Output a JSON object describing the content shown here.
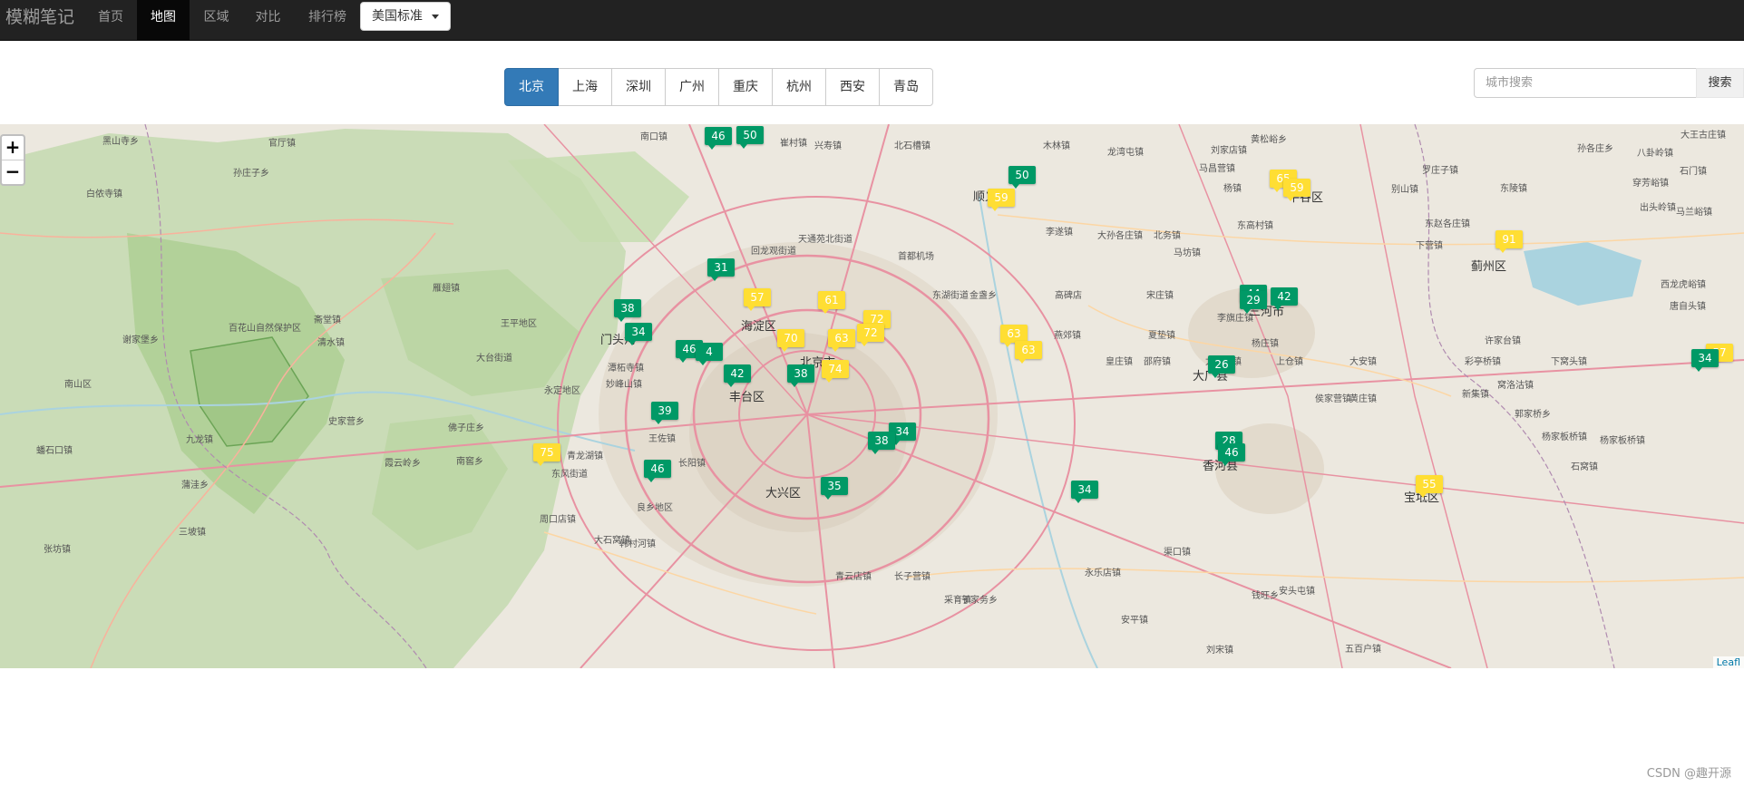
{
  "navbar": {
    "brand": "模糊笔记",
    "items": [
      {
        "label": "首页",
        "active": false
      },
      {
        "label": "地图",
        "active": true
      },
      {
        "label": "区域",
        "active": false
      },
      {
        "label": "对比",
        "active": false
      },
      {
        "label": "排行榜",
        "active": false
      }
    ],
    "dropdown_label": "美国标准"
  },
  "city_tabs": [
    {
      "label": "北京",
      "active": true
    },
    {
      "label": "上海",
      "active": false
    },
    {
      "label": "深圳",
      "active": false
    },
    {
      "label": "广州",
      "active": false
    },
    {
      "label": "重庆",
      "active": false
    },
    {
      "label": "杭州",
      "active": false
    },
    {
      "label": "西安",
      "active": false
    },
    {
      "label": "青岛",
      "active": false
    }
  ],
  "search": {
    "placeholder": "城市搜索",
    "button_label": "搜索"
  },
  "map": {
    "zoom_in": "+",
    "zoom_out": "−",
    "attribution": "Leafl",
    "colors": {
      "good": "#009966",
      "moderate": "#ffde33"
    },
    "labels": [
      {
        "text": "北京市",
        "major": true
      },
      {
        "text": "海淀区",
        "major": true
      },
      {
        "text": "丰台区",
        "major": true
      },
      {
        "text": "大兴区",
        "major": true
      },
      {
        "text": "顺义区",
        "major": true
      },
      {
        "text": "门头沟",
        "major": true
      },
      {
        "text": "大厂县",
        "major": true
      },
      {
        "text": "香河县",
        "major": true
      },
      {
        "text": "三河市",
        "major": true
      },
      {
        "text": "平谷区",
        "major": true
      },
      {
        "text": "蓟州区",
        "major": true
      },
      {
        "text": "宝坻区",
        "major": true
      },
      {
        "text": "百花山自然保护区",
        "major": false
      },
      {
        "text": "官厅镇",
        "major": false
      },
      {
        "text": "南口镇",
        "major": false
      },
      {
        "text": "崔村镇",
        "major": false
      },
      {
        "text": "兴寿镇",
        "major": false
      },
      {
        "text": "北石槽镇",
        "major": false
      },
      {
        "text": "木林镇",
        "major": false
      },
      {
        "text": "龙湾屯镇",
        "major": false
      },
      {
        "text": "刘家店镇",
        "major": false
      },
      {
        "text": "黄松峪乡",
        "major": false
      },
      {
        "text": "马昌营镇",
        "major": false
      },
      {
        "text": "杨镇",
        "major": false
      },
      {
        "text": "李遂镇",
        "major": false
      },
      {
        "text": "北务镇",
        "major": false
      },
      {
        "text": "大孙各庄镇",
        "major": false
      },
      {
        "text": "马坊镇",
        "major": false
      },
      {
        "text": "东高村镇",
        "major": false
      },
      {
        "text": "天通苑北街道",
        "major": false
      },
      {
        "text": "回龙观街道",
        "major": false
      },
      {
        "text": "首都机场",
        "major": false
      },
      {
        "text": "东湖街道",
        "major": false
      },
      {
        "text": "金盏乡",
        "major": false
      },
      {
        "text": "高碑店",
        "major": false
      },
      {
        "text": "宋庄镇",
        "major": false
      },
      {
        "text": "燕郊镇",
        "major": false
      },
      {
        "text": "夏垫镇",
        "major": false
      },
      {
        "text": "李旗庄镇",
        "major": false
      },
      {
        "text": "杨庄镇",
        "major": false
      },
      {
        "text": "邵府镇",
        "major": false
      },
      {
        "text": "皇庄镇",
        "major": false
      },
      {
        "text": "尤古庄镇",
        "major": false
      },
      {
        "text": "上仓镇",
        "major": false
      },
      {
        "text": "大安镇",
        "major": false
      },
      {
        "text": "彩亭桥镇",
        "major": false
      },
      {
        "text": "下窝头镇",
        "major": false
      },
      {
        "text": "新集镇",
        "major": false
      },
      {
        "text": "侯家营镇",
        "major": false
      },
      {
        "text": "黄庄镇",
        "major": false
      },
      {
        "text": "郭家桥乡",
        "major": false
      },
      {
        "text": "杨家板桥镇",
        "major": false
      },
      {
        "text": "石窝镇",
        "major": false
      },
      {
        "text": "良乡地区",
        "major": false
      },
      {
        "text": "长阳镇",
        "major": false
      },
      {
        "text": "王佐镇",
        "major": false
      },
      {
        "text": "青龙湖镇",
        "major": false
      },
      {
        "text": "东风街道",
        "major": false
      },
      {
        "text": "周口店镇",
        "major": false
      },
      {
        "text": "韩村河镇",
        "major": false
      },
      {
        "text": "大石窝镇",
        "major": false
      },
      {
        "text": "佛子庄乡",
        "major": false
      },
      {
        "text": "史家营乡",
        "major": false
      },
      {
        "text": "霞云岭乡",
        "major": false
      },
      {
        "text": "蒲洼乡",
        "major": false
      },
      {
        "text": "南窖乡",
        "major": false
      },
      {
        "text": "九龙镇",
        "major": false
      },
      {
        "text": "三坡镇",
        "major": false
      },
      {
        "text": "清水镇",
        "major": false
      },
      {
        "text": "斋堂镇",
        "major": false
      },
      {
        "text": "雁翅镇",
        "major": false
      },
      {
        "text": "王平地区",
        "major": false
      },
      {
        "text": "大台街道",
        "major": false
      },
      {
        "text": "妙峰山镇",
        "major": false
      },
      {
        "text": "潭柘寺镇",
        "major": false
      },
      {
        "text": "永定地区",
        "major": false
      },
      {
        "text": "黑山寺乡",
        "major": false
      },
      {
        "text": "孙庄子乡",
        "major": false
      },
      {
        "text": "白侬寺镇",
        "major": false
      },
      {
        "text": "谢家堡乡",
        "major": false
      },
      {
        "text": "南山区",
        "major": false
      },
      {
        "text": "蟠石口镇",
        "major": false
      },
      {
        "text": "张坊镇",
        "major": false
      },
      {
        "text": "青云店镇",
        "major": false
      },
      {
        "text": "长子营镇",
        "major": false
      },
      {
        "text": "采育镇",
        "major": false
      },
      {
        "text": "于家务乡",
        "major": false
      },
      {
        "text": "永乐店镇",
        "major": false
      },
      {
        "text": "安平镇",
        "major": false
      },
      {
        "text": "渠口镇",
        "major": false
      },
      {
        "text": "钱旺乡",
        "major": false
      },
      {
        "text": "安头屯镇",
        "major": false
      },
      {
        "text": "刘宋镇",
        "major": false
      },
      {
        "text": "五百户镇",
        "major": false
      },
      {
        "text": "大王古庄镇",
        "major": false
      },
      {
        "text": "八卦岭镇",
        "major": false
      },
      {
        "text": "石门镇",
        "major": false
      },
      {
        "text": "马兰峪镇",
        "major": false
      },
      {
        "text": "出头岭镇",
        "major": false
      },
      {
        "text": "西龙虎峪镇",
        "major": false
      },
      {
        "text": "唐自头镇",
        "major": false
      },
      {
        "text": "杨家板桥镇",
        "major": false
      },
      {
        "text": "窝洛沽镇",
        "major": false
      },
      {
        "text": "许家台镇",
        "major": false
      },
      {
        "text": "东赵各庄镇",
        "major": false
      },
      {
        "text": "别山镇",
        "major": false
      },
      {
        "text": "下营镇",
        "major": false
      },
      {
        "text": "罗庄子镇",
        "major": false
      },
      {
        "text": "孙各庄乡",
        "major": false
      },
      {
        "text": "东陵镇",
        "major": false
      },
      {
        "text": "穿芳峪镇",
        "major": false
      }
    ],
    "markers": [
      {
        "value": "46",
        "level": "good"
      },
      {
        "value": "50",
        "level": "good"
      },
      {
        "value": "50",
        "level": "good"
      },
      {
        "value": "59",
        "level": "moderate"
      },
      {
        "value": "65",
        "level": "moderate"
      },
      {
        "value": "59",
        "level": "moderate"
      },
      {
        "value": "91",
        "level": "moderate"
      },
      {
        "value": "31",
        "level": "good"
      },
      {
        "value": "57",
        "level": "moderate"
      },
      {
        "value": "61",
        "level": "moderate"
      },
      {
        "value": "38",
        "level": "good"
      },
      {
        "value": "34",
        "level": "good"
      },
      {
        "value": "72",
        "level": "moderate"
      },
      {
        "value": "72",
        "level": "moderate"
      },
      {
        "value": "63",
        "level": "moderate"
      },
      {
        "value": "70",
        "level": "moderate"
      },
      {
        "value": "63",
        "level": "moderate"
      },
      {
        "value": "63",
        "level": "moderate"
      },
      {
        "value": "46",
        "level": "good"
      },
      {
        "value": "4",
        "level": "good"
      },
      {
        "value": "42",
        "level": "good"
      },
      {
        "value": "38",
        "level": "good"
      },
      {
        "value": "74",
        "level": "moderate"
      },
      {
        "value": "44",
        "level": "good"
      },
      {
        "value": "42",
        "level": "good"
      },
      {
        "value": "29",
        "level": "good"
      },
      {
        "value": "26",
        "level": "good"
      },
      {
        "value": "39",
        "level": "good"
      },
      {
        "value": "34",
        "level": "good"
      },
      {
        "value": "38",
        "level": "good"
      },
      {
        "value": "75",
        "level": "moderate"
      },
      {
        "value": "46",
        "level": "good"
      },
      {
        "value": "35",
        "level": "good"
      },
      {
        "value": "34",
        "level": "good"
      },
      {
        "value": "28",
        "level": "good"
      },
      {
        "value": "46",
        "level": "good"
      },
      {
        "value": "55",
        "level": "moderate"
      },
      {
        "value": "57",
        "level": "moderate"
      },
      {
        "value": "34",
        "level": "good"
      }
    ]
  },
  "footer": {
    "watermark": "CSDN @趣开源"
  }
}
